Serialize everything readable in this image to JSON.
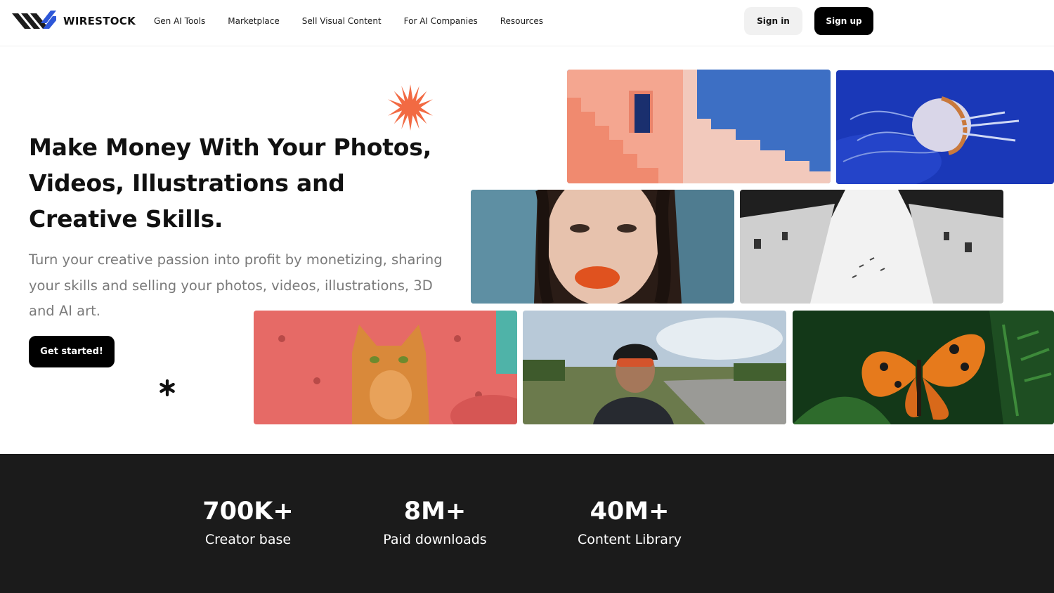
{
  "brand": {
    "name": "WIRESTOCK",
    "colors": {
      "dark": "#1c1c1c",
      "blue": "#2d57d8",
      "accent_orange": "#f26a43"
    }
  },
  "nav": {
    "links": [
      "Gen AI Tools",
      "Marketplace",
      "Sell Visual Content",
      "For AI Companies",
      "Resources"
    ],
    "sign_in": "Sign in",
    "sign_up": "Sign up"
  },
  "hero": {
    "headline": "Make Money With Your Photos, Videos, Illustrations and Creative Skills.",
    "subtext": "Turn your creative passion into profit by monetizing, sharing your skills and selling your photos, videos, illustrations, 3D and AI art.",
    "cta": "Get started!",
    "decorations": [
      "orange-starburst-icon",
      "black-asterisk-icon"
    ]
  },
  "gallery": [
    "pink-staircase-architecture",
    "jellyfish",
    "woman-orange-lips-portrait",
    "building-facades-birds",
    "orange-cat-red-couch",
    "cyclist-on-road",
    "orange-butterfly-leaves"
  ],
  "stats": [
    {
      "value": "700K+",
      "label": "Creator base"
    },
    {
      "value": "8M+",
      "label": "Paid downloads"
    },
    {
      "value": "40M+",
      "label": "Content Library"
    }
  ]
}
